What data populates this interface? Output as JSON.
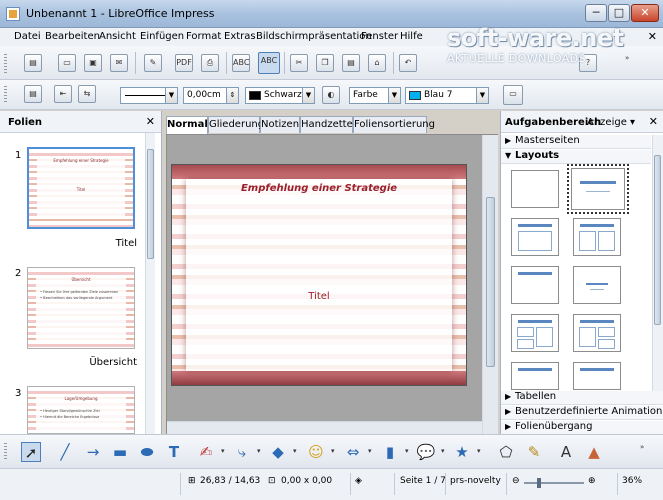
{
  "window": {
    "title": "Unbenannt 1 - LibreOffice Impress",
    "minimize": "─",
    "maximize": "□",
    "close": "✕"
  },
  "watermark": {
    "brand": "soft-ware.net",
    "tagline": "AKTUELLE DOWNLOADS"
  },
  "menu": {
    "items": [
      "Datei",
      "Bearbeiten",
      "Ansicht",
      "Einfügen",
      "Format",
      "Extras",
      "Bildschirmpräsentation",
      "Fenster",
      "Hilfe"
    ],
    "close_doc": "✕"
  },
  "toolbar2": {
    "line_width": "0,00cm",
    "line_color": "Schwarz",
    "line_color_hex": "#000000",
    "fill_type": "Farbe",
    "fill_color": "Blau 7",
    "fill_color_hex": "#00b0f0"
  },
  "slides_pane": {
    "title": "Folien",
    "close": "✕",
    "slides": [
      {
        "number": "1",
        "name": "Titel",
        "thumb_title": "Empfehlung einer Strategie",
        "thumb_body": "Titel"
      },
      {
        "number": "2",
        "name": "Übersicht",
        "thumb_title": "Übersicht",
        "bullet1": "• Fassen Sie Ihre geltenden Ziele zusammen",
        "bullet2": "• Beschreiben das vorliegende Argument"
      },
      {
        "number": "3",
        "name": "",
        "thumb_title": "Lage/Umgebung",
        "bullet1": "• Heutiger Stand/gewünschte Ziel",
        "bullet2": "• Hiermit die Bereiche Ergebnisse"
      }
    ]
  },
  "view_tabs": [
    "Normal",
    "Gliederung",
    "Notizen",
    "Handzettel",
    "Foliensortierung"
  ],
  "active_tab": "Normal",
  "slide": {
    "title": "Empfehlung einer Strategie",
    "body": "Titel"
  },
  "task_pane": {
    "title": "Aufgabenbereich",
    "view_menu": "Anzeige ▾",
    "close": "✕",
    "sections": {
      "masterseiten": "Masterseiten",
      "layouts": "Layouts",
      "tabellen": "Tabellen",
      "animation": "Benutzerdefinierte Animation",
      "uebergang": "Folienübergang"
    }
  },
  "statusbar": {
    "position": "26,83 / 14,63",
    "size": "0,00 x 0,00",
    "page": "Seite 1 / 7",
    "master": "prs-novelty",
    "zoom": "36%"
  },
  "colors": {
    "slide_title": "#9c1f2b",
    "selection": "#4f8ed8"
  }
}
